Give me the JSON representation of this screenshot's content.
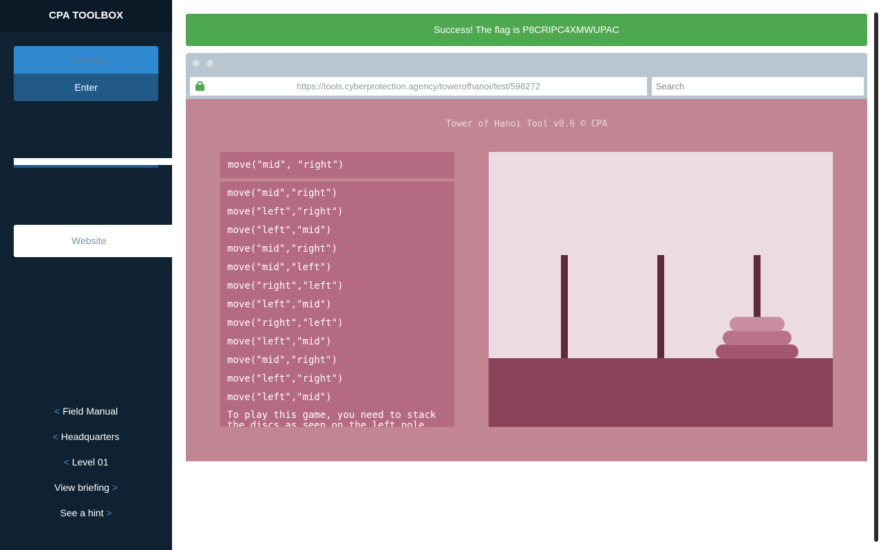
{
  "sidebar": {
    "title": "CPA TOOLBOX",
    "flag_placeholder": "Insert flag",
    "enter_label": "Enter",
    "website_label": "Website",
    "links": {
      "field_manual": "Field Manual",
      "headquarters": "Headquarters",
      "level": "Level 01",
      "view_briefing": "View briefing",
      "see_hint": "See a hint"
    },
    "arrow_left": "<",
    "arrow_right": ">"
  },
  "banner": {
    "message": "Success! The flag is P8CRIPC4XMWUPAC",
    "color": "#4ea84f"
  },
  "browser": {
    "url": "https://tools.cyberprotection.agency/towerofhanoi/test/598272",
    "search_placeholder": "Search",
    "lock_icon": "lock-icon"
  },
  "app": {
    "title": "Tower of Hanoi Tool v0.6 © CPA",
    "command_value": "move(\"mid\", \"right\")",
    "history": [
      "move(\"mid\",\"right\")",
      "move(\"left\",\"right\")",
      "move(\"left\",\"mid\")",
      "move(\"mid\",\"right\")",
      "move(\"mid\",\"left\")",
      "move(\"right\",\"left\")",
      "move(\"left\",\"mid\")",
      "move(\"right\",\"left\")",
      "move(\"left\",\"mid\")",
      "move(\"mid\",\"right\")",
      "move(\"left\",\"right\")",
      "move(\"left\",\"mid\")"
    ],
    "help_text": "To play this game, you need to stack the discs as seen on the left pole onto the right pole.",
    "pegs": [
      "left",
      "mid",
      "right"
    ],
    "disks": [
      {
        "peg": "right",
        "level": 1,
        "color": "#a4566e"
      },
      {
        "peg": "right",
        "level": 2,
        "color": "#b8738a"
      },
      {
        "peg": "right",
        "level": 3,
        "color": "#c88e9f"
      }
    ]
  }
}
